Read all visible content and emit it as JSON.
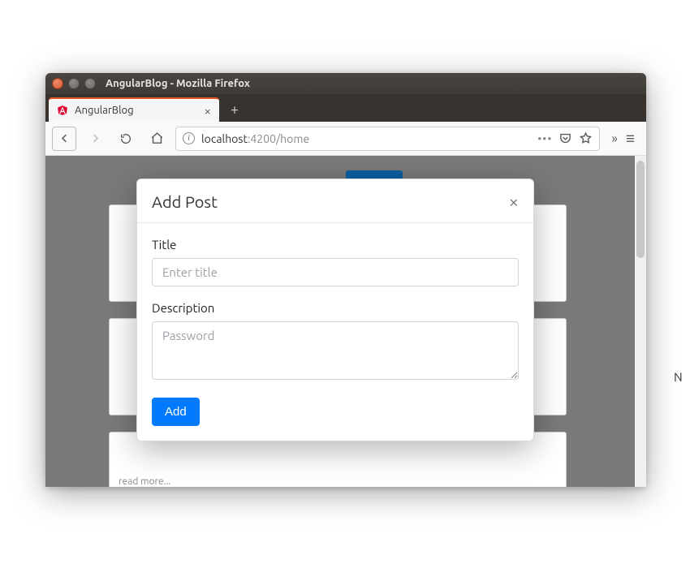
{
  "os_titlebar": {
    "title": "AngularBlog - Mozilla Firefox"
  },
  "tab": {
    "title": "AngularBlog",
    "close_glyph": "×",
    "newtab_glyph": "+"
  },
  "address": {
    "info_glyph": "i",
    "host": "localhost",
    "rest": ":4200/home",
    "dots": "•••",
    "overflow_glyph": "»",
    "menu_glyph": "≡"
  },
  "modal": {
    "title": "Add Post",
    "close_glyph": "×",
    "title_label": "Title",
    "title_placeholder": "Enter title",
    "desc_label": "Description",
    "desc_placeholder": "Password",
    "submit_label": "Add"
  },
  "background": {
    "read_more": "read more..."
  },
  "stray": {
    "n": "N"
  }
}
